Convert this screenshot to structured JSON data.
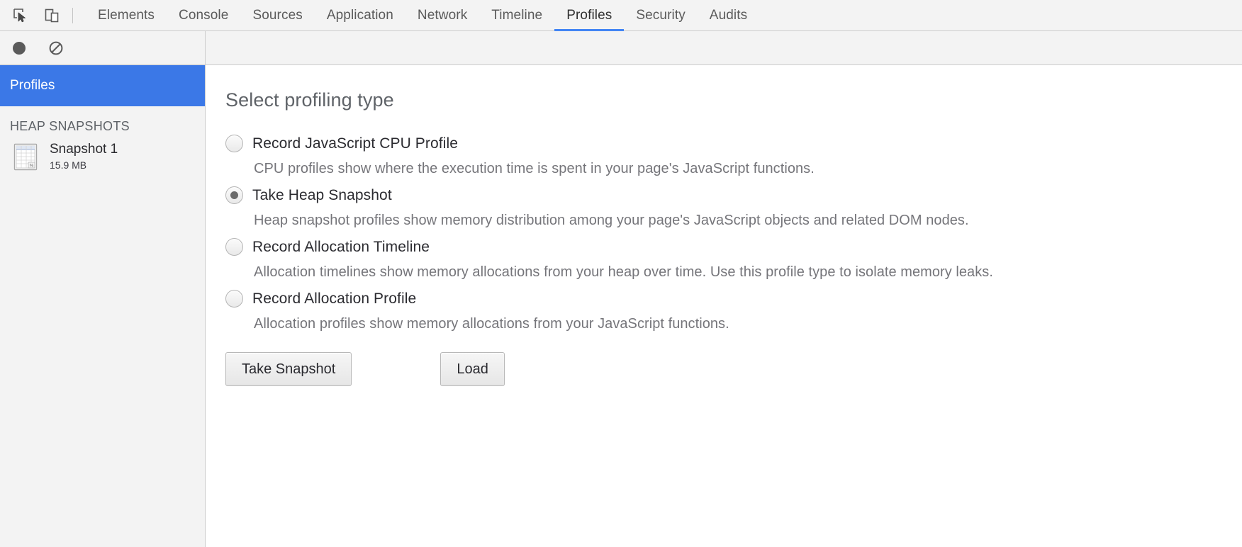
{
  "toolbar_top": {
    "inspect_icon": "inspect-cursor-icon",
    "device_icon": "device-toolbar-icon",
    "tabs": [
      {
        "label": "Elements",
        "active": false
      },
      {
        "label": "Console",
        "active": false
      },
      {
        "label": "Sources",
        "active": false
      },
      {
        "label": "Application",
        "active": false
      },
      {
        "label": "Network",
        "active": false
      },
      {
        "label": "Timeline",
        "active": false
      },
      {
        "label": "Profiles",
        "active": true
      },
      {
        "label": "Security",
        "active": false
      },
      {
        "label": "Audits",
        "active": false
      }
    ],
    "active_tab": "Profiles",
    "active_underline_color": "#4285f4"
  },
  "toolbar_second": {
    "record_icon": "record-circle-icon",
    "clear_icon": "clear-no-entry-icon"
  },
  "sidebar": {
    "selected_item": "Profiles",
    "selected_color": "#3b78e7",
    "section_header": "HEAP SNAPSHOTS",
    "snapshots": [
      {
        "icon": "heap-snapshot-grid-icon",
        "title": "Snapshot 1",
        "size": "15.9 MB"
      }
    ]
  },
  "main": {
    "title": "Select profiling type",
    "options": [
      {
        "label": "Record JavaScript CPU Profile",
        "description": "CPU profiles show where the execution time is spent in your page's JavaScript functions.",
        "checked": false
      },
      {
        "label": "Take Heap Snapshot",
        "description": "Heap snapshot profiles show memory distribution among your page's JavaScript objects and related DOM nodes.",
        "checked": true
      },
      {
        "label": "Record Allocation Timeline",
        "description": "Allocation timelines show memory allocations from your heap over time. Use this profile type to isolate memory leaks.",
        "checked": false
      },
      {
        "label": "Record Allocation Profile",
        "description": "Allocation profiles show memory allocations from your JavaScript functions.",
        "checked": false
      }
    ],
    "buttons": {
      "primary": "Take Snapshot",
      "secondary": "Load"
    }
  }
}
